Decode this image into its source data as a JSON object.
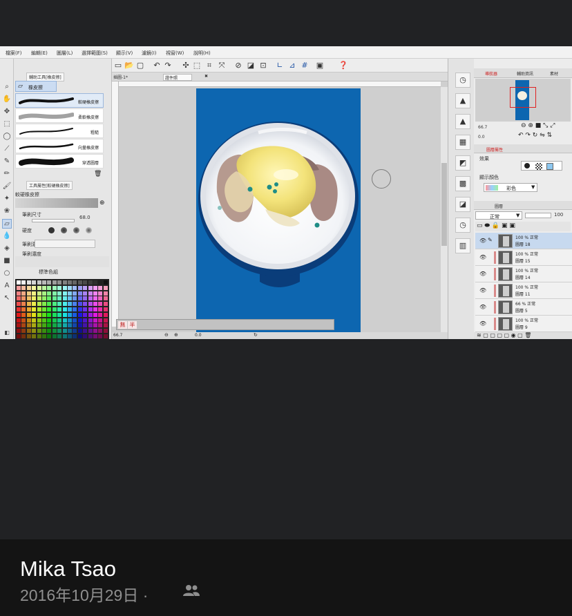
{
  "menu": [
    "檔案(F)",
    "編輯(E)",
    "圖層(L)",
    "選擇範圍(S)",
    "顯示(V)",
    "濾鏡(I)",
    "視窗(W)",
    "說明(H)"
  ],
  "tool_panel": {
    "tab": "輔助工具[橡皮擦]",
    "active_tool": "橡皮擦",
    "brushes": [
      "較硬橡皮擦",
      "柔軟橡皮擦",
      "粗糙",
      "向量橡皮擦",
      "穿透圖層"
    ],
    "property_tab": "工具屬性[較硬橡皮擦]",
    "property_title": "較硬橡皮擦",
    "brush_size_label": "筆刷尺寸",
    "brush_size_value": "68.0",
    "hardness_label": "硬度",
    "density_label": "筆刷濃度",
    "color_set_label": "標準色組"
  },
  "document_tabs": [
    "插圖-1*",
    "證件照"
  ],
  "status": {
    "zoom": "66.7",
    "angle": "0.0",
    "none_label": "無",
    "half_label": "半"
  },
  "navigator": {
    "tabs": [
      "導航器",
      "輔助資訊",
      "圖層屬性",
      "素材"
    ],
    "zoom": "66.7",
    "rotation": "0.0"
  },
  "layer_property": {
    "effect_label": "效果",
    "display_color_label": "顯示顏色",
    "color_mode": "彩色"
  },
  "layers_panel": {
    "tab": "圖層",
    "blend_mode": "正常",
    "opacity": "100",
    "layers": [
      {
        "opacity": "100 %",
        "mode": "正常",
        "name": "圖層 18",
        "selected": true
      },
      {
        "opacity": "100 %",
        "mode": "正常",
        "name": "圖層 15",
        "selected": false
      },
      {
        "opacity": "100 %",
        "mode": "正常",
        "name": "圖層 14",
        "selected": false
      },
      {
        "opacity": "100 %",
        "mode": "正常",
        "name": "圖層 11",
        "selected": false
      },
      {
        "opacity": "66 %",
        "mode": "正常",
        "name": "圖層 5",
        "selected": false
      },
      {
        "opacity": "100 %",
        "mode": "正常",
        "name": "圖層 9",
        "selected": false
      }
    ]
  },
  "post": {
    "author": "Mika Tsao",
    "date": "2016年10月29日",
    "separator": "·",
    "audience_icon": "friends-icon"
  },
  "colors": {
    "viewer_bg": "#212224",
    "footer_bg": "#141414",
    "canvas_blue": "#0d66b0",
    "bowl_navy": "#0a3d7a",
    "selected_layer": "#c7d9ef"
  }
}
